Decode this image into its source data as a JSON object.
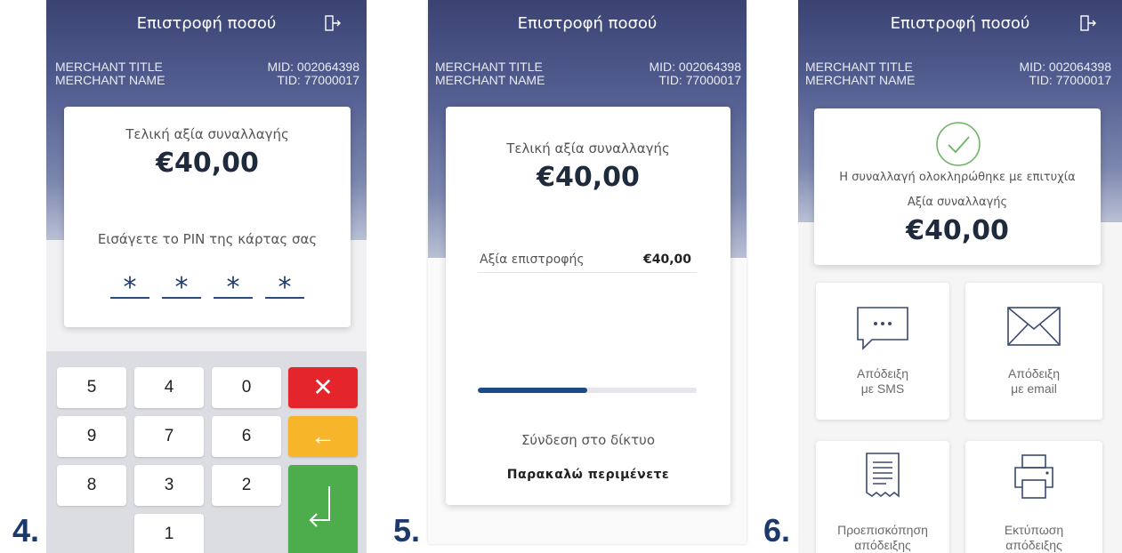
{
  "step_labels": [
    "4.",
    "5.",
    "6."
  ],
  "colors": {
    "header_dark": "#3a4372",
    "accent_blue": "#1e4a86",
    "cancel_red": "#e4252b",
    "clear_yellow": "#f7b529",
    "enter_green": "#4dad4c",
    "success_green": "#6cb562"
  },
  "screen4": {
    "title": "Επιστροφή ποσού",
    "exit_icon": "logout-icon",
    "merchant_title": "MERCHANT TITLE",
    "merchant_name": "MERCHANT NAME",
    "mid": "MID: 002064398",
    "tid": "TID: 77000017",
    "amount_label": "Τελική αξία συναλλαγής",
    "amount": "€40,00",
    "pin_prompt": "Εισάγετε το PIN της κάρτας σας",
    "pin_digits": [
      "*",
      "*",
      "*",
      "*"
    ],
    "keypad": {
      "keys": [
        "5",
        "4",
        "0",
        "9",
        "7",
        "6",
        "8",
        "3",
        "2",
        "1"
      ],
      "cancel": "✕",
      "clear": "←",
      "enter": "↵"
    }
  },
  "screen5": {
    "title": "Επιστροφή ποσού",
    "merchant_title": "MERCHANT TITLE",
    "merchant_name": "MERCHANT NAME",
    "mid": "MID: 002064398",
    "tid": "TID: 77000017",
    "amount_label": "Τελική αξία συναλλαγής",
    "amount": "€40,00",
    "refund_label": "Αξία επιστροφής",
    "refund_value": "€40,00",
    "progress_fraction": 0.5,
    "status": "Σύνδεση στο δίκτυο",
    "wait": "Παρακαλώ περιμένετε"
  },
  "screen6": {
    "title": "Επιστροφή ποσού",
    "exit_icon": "logout-icon",
    "merchant_title": "MERCHANT TITLE",
    "merchant_name": "MERCHANT NAME",
    "mid": "MID: 002064398",
    "tid": "TID: 77000017",
    "success_icon": "check-circle-icon",
    "success_msg": "Η συναλλαγή ολοκληρώθηκε με επιτυχία",
    "amount_label": "Αξία συναλλαγής",
    "amount": "€40,00",
    "tiles": [
      {
        "icon": "sms-icon",
        "line1": "Απόδειξη",
        "line2": "με SMS"
      },
      {
        "icon": "email-icon",
        "line1": "Απόδειξη",
        "line2": "με email"
      },
      {
        "icon": "receipt-icon",
        "line1": "Προεπισκόπηση",
        "line2": "απόδειξης"
      },
      {
        "icon": "printer-icon",
        "line1": "Εκτύπωση",
        "line2": "απόδειξης"
      }
    ]
  }
}
